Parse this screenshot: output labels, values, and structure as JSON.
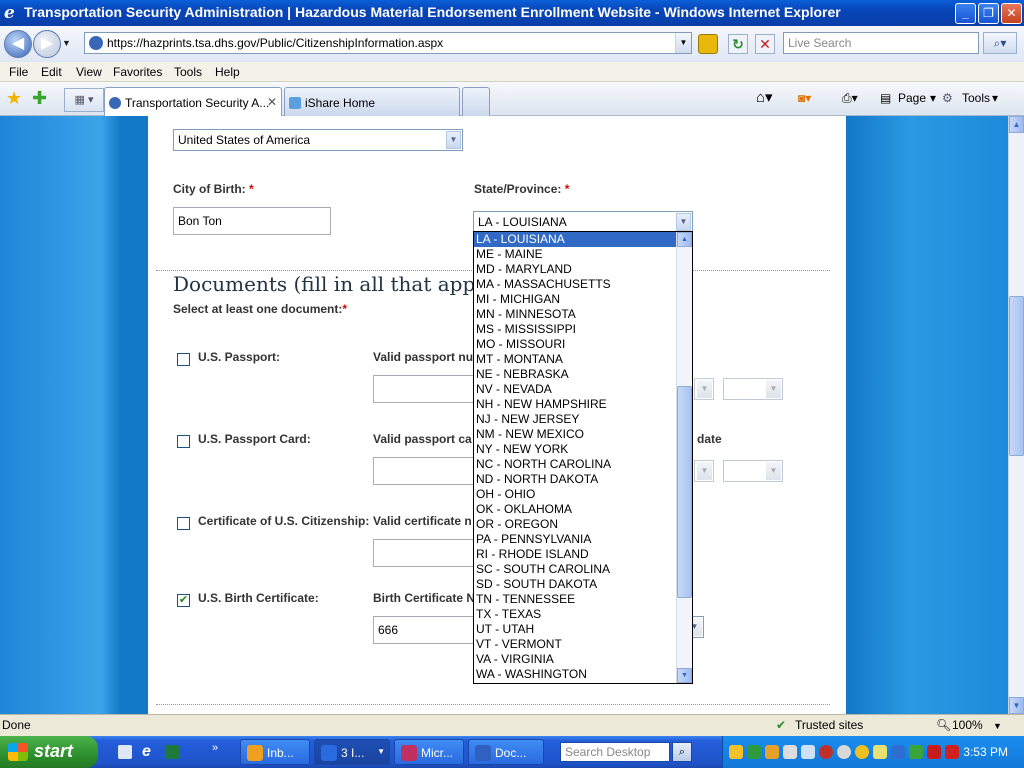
{
  "window": {
    "title": "Transportation Security Administration | Hazardous Material Endorsement Enrollment Website - Windows Internet Explorer"
  },
  "address_bar": {
    "url": "https://hazprints.tsa.dhs.gov/Public/CitizenshipInformation.aspx",
    "search_placeholder": "Live Search"
  },
  "menu": [
    "File",
    "Edit",
    "View",
    "Favorites",
    "Tools",
    "Help"
  ],
  "tabs": [
    {
      "label": "Transportation Security A...",
      "active": true
    },
    {
      "label": "iShare Home",
      "active": false
    }
  ],
  "command_bar": {
    "page": "Page",
    "tools": "Tools"
  },
  "form": {
    "country": "United States of America",
    "city_label": "City of Birth:",
    "city_value": "Bon Ton",
    "state_label": "State/Province:",
    "state_value": "LA - LOUISIANA",
    "required_mark": "*",
    "documents_heading": "Documents (fill in all that apply):",
    "select_doc_label": "Select at least one document:",
    "documents": [
      {
        "label": "U.S. Passport:",
        "field_label": "Valid passport nu",
        "checked": false,
        "value": ""
      },
      {
        "label": "U.S. Passport Card:",
        "field_label": "Valid passport ca",
        "checked": false,
        "value": "",
        "extra_label": "date"
      },
      {
        "label": "Certificate of U.S. Citizenship:",
        "field_label": "Valid certificate n",
        "checked": false,
        "value": ""
      },
      {
        "label": "U.S. Birth Certificate:",
        "field_label": "Birth Certificate N",
        "checked": true,
        "value": "666"
      }
    ]
  },
  "state_options": [
    "LA - LOUISIANA",
    "ME - MAINE",
    "MD - MARYLAND",
    "MA - MASSACHUSETTS",
    "MI - MICHIGAN",
    "MN - MINNESOTA",
    "MS - MISSISSIPPI",
    "MO - MISSOURI",
    "MT - MONTANA",
    "NE - NEBRASKA",
    "NV - NEVADA",
    "NH - NEW HAMPSHIRE",
    "NJ - NEW JERSEY",
    "NM - NEW MEXICO",
    "NY - NEW YORK",
    "NC - NORTH CAROLINA",
    "ND - NORTH DAKOTA",
    "OH - OHIO",
    "OK - OKLAHOMA",
    "OR - OREGON",
    "PA - PENNSYLVANIA",
    "RI - RHODE ISLAND",
    "SC - SOUTH CAROLINA",
    "SD - SOUTH DAKOTA",
    "TN - TENNESSEE",
    "TX - TEXAS",
    "UT - UTAH",
    "VT - VERMONT",
    "VA - VIRGINIA",
    "WA - WASHINGTON"
  ],
  "selected_state_index": 0,
  "status_bar": {
    "left": "Done",
    "zone": "Trusted sites",
    "zoom": "100%"
  },
  "taskbar": {
    "start": "start",
    "tasks": [
      {
        "label": "Inb...",
        "icon_color": "#f0a020"
      },
      {
        "label": "3 I...",
        "icon_color": "#2a6ae0",
        "active": true
      },
      {
        "label": "Micr...",
        "icon_color": "#c03060"
      },
      {
        "label": "Doc...",
        "icon_color": "#3060c0"
      }
    ],
    "search_placeholder": "Search Desktop",
    "clock": "3:53 PM"
  },
  "colors": {
    "accent": "#316ac5",
    "required": "#dd0000",
    "title_bar": "#0a5fd8"
  }
}
